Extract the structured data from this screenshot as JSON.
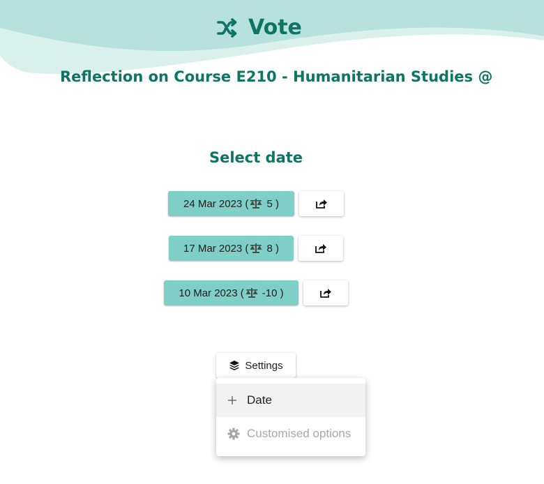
{
  "header": {
    "title": "Vote",
    "title_icon": "shuffle-icon",
    "subtitle": "Reflection on Course E210 - Humanitarian Studies @"
  },
  "main": {
    "section_title": "Select date",
    "dates": [
      {
        "date": "24 Mar 2023",
        "score": "5",
        "icon": "balance-scale-icon"
      },
      {
        "date": "17 Mar 2023",
        "score": "8",
        "icon": "balance-scale-icon"
      },
      {
        "date": "10 Mar 2023",
        "score": "-10",
        "icon": "balance-scale-icon"
      }
    ],
    "share_icon": "share-icon"
  },
  "settings": {
    "label": "Settings",
    "icon": "layers-icon",
    "menu": [
      {
        "label": "Date",
        "icon": "plus-icon",
        "enabled": true
      },
      {
        "label": "Customised options",
        "icon": "gear-icon",
        "enabled": false
      }
    ]
  },
  "colors": {
    "accent": "#0e7463",
    "button_bg": "#7fcfc6",
    "wave_light": "#b6e1dc",
    "wave_lighter": "#d9f0ed"
  }
}
